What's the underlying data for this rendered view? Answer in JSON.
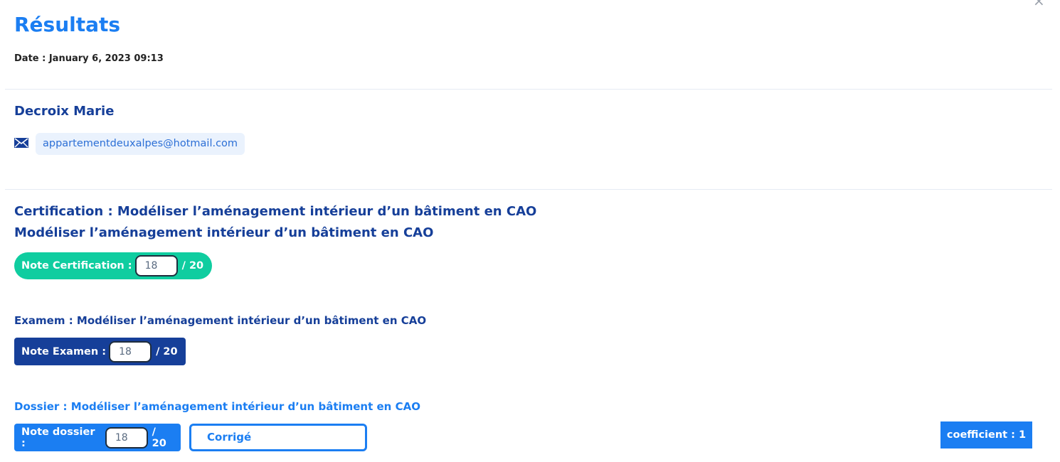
{
  "header": {
    "title": "Résultats",
    "date": "Date : January 6, 2023 09:13",
    "close_icon": "close-icon"
  },
  "person": {
    "name": "Decroix Marie",
    "email": "appartementdeuxalpes@hotmail.com",
    "email_icon": "envelope-icon"
  },
  "certification": {
    "title_line1": "Certification : Modéliser l’aménagement intérieur d’un bâtiment en CAO",
    "title_line2": "Modéliser l’aménagement intérieur d’un bâtiment en CAO",
    "note_label": "Note Certification :",
    "note_value": "18",
    "note_max": "/ 20"
  },
  "exam": {
    "label": "Examem : Modéliser l’aménagement intérieur d’un bâtiment en CAO",
    "note_label": "Note Examen :",
    "note_value": "18",
    "note_max": "/ 20"
  },
  "dossier": {
    "label": "Dossier : Modéliser l’aménagement intérieur d’un bâtiment en CAO",
    "note_label": "Note dossier :",
    "note_value": "18",
    "note_max": "/ 20",
    "status": "Corrigé",
    "coefficient": "coefficient : 1"
  },
  "colors": {
    "accent": "#1b7ef2",
    "navy": "#163f99",
    "teal": "#0fcda0"
  }
}
